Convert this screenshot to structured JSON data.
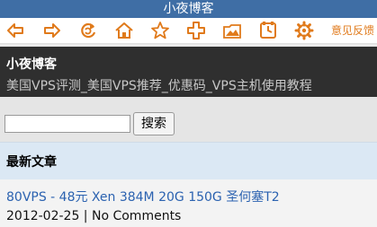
{
  "window": {
    "title": "小夜博客"
  },
  "toolbar": {
    "icons": [
      "back-icon",
      "forward-icon",
      "refresh-icon",
      "home-icon",
      "bookmark-star-icon",
      "add-icon",
      "image-icon",
      "history-icon",
      "settings-icon"
    ],
    "feedback_label": "意见反馈",
    "accent_color": "#e07a1b"
  },
  "header": {
    "site_title": "小夜博客",
    "site_description": "美国VPS评测_美国VPS推荐_优惠码_VPS主机使用教程"
  },
  "search": {
    "input_value": "",
    "button_label": "搜索"
  },
  "section": {
    "title": "最新文章"
  },
  "posts": [
    {
      "title": "80VPS - 48元 Xen 384M 20G 150G 圣何塞T2",
      "meta": "2012-02-25 | No Comments"
    }
  ]
}
